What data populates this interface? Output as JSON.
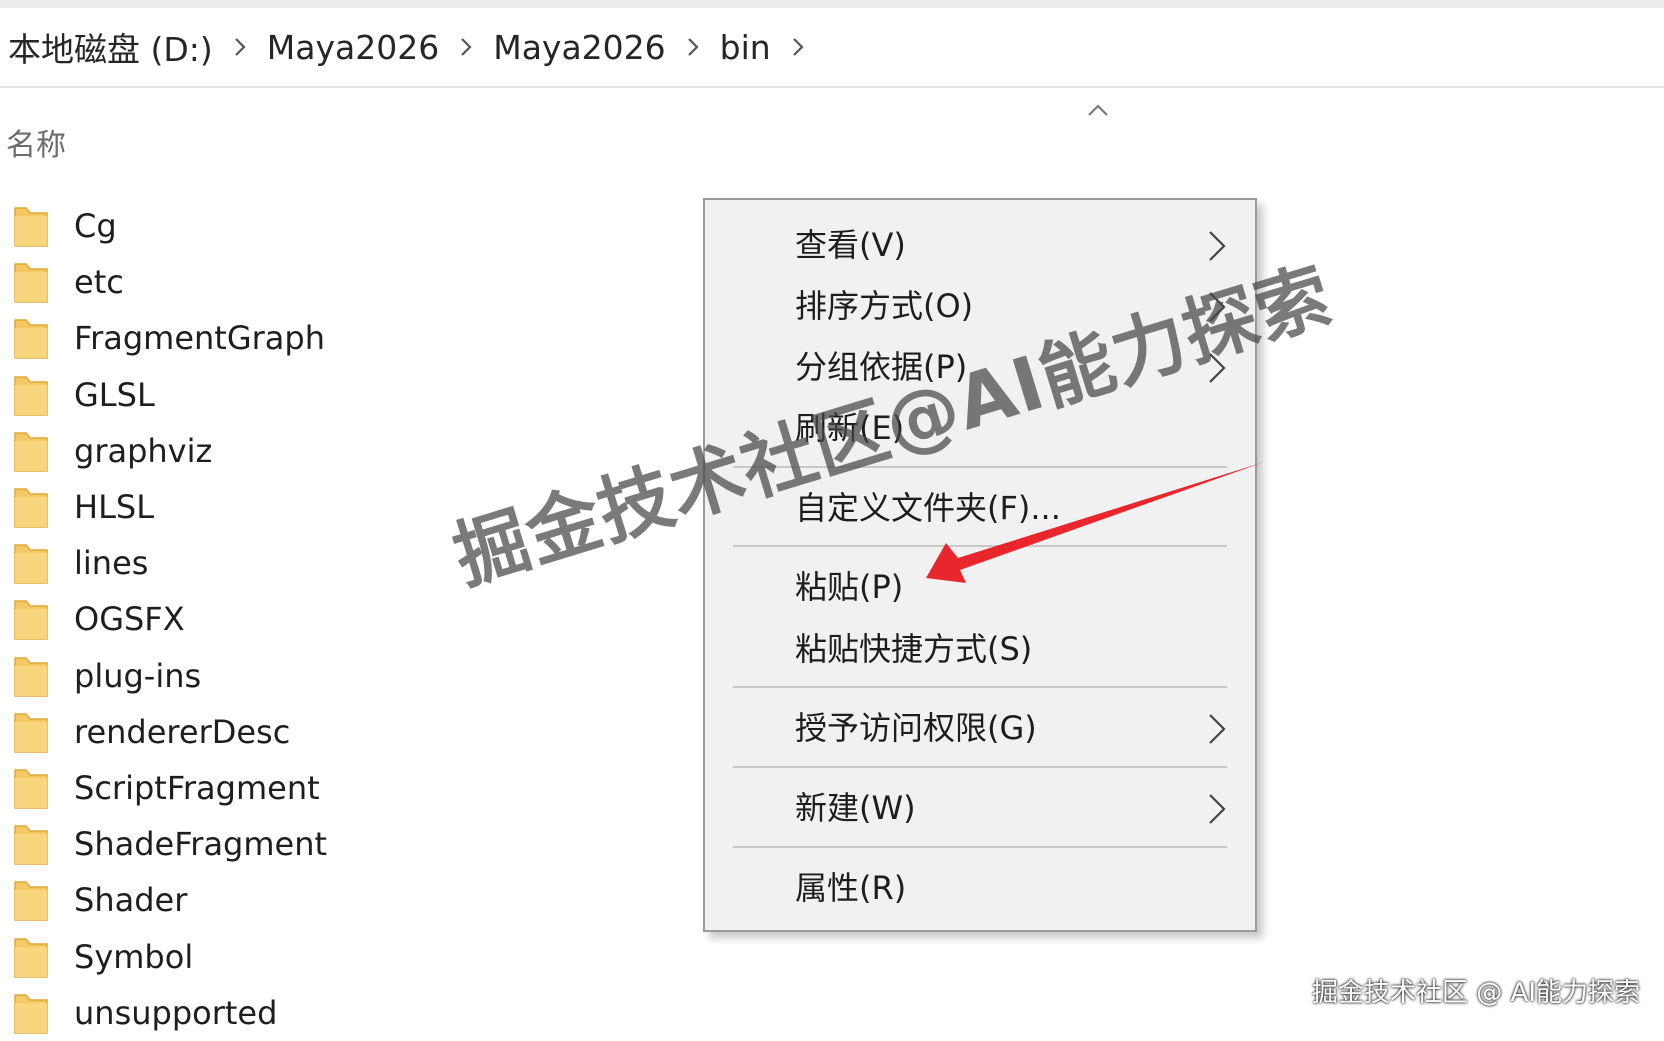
{
  "breadcrumb": [
    "本地磁盘 (D:)",
    "Maya2026",
    "Maya2026",
    "bin"
  ],
  "column_header": "名称",
  "files": [
    "Cg",
    "etc",
    "FragmentGraph",
    "GLSL",
    "graphviz",
    "HLSL",
    "lines",
    "OGSFX",
    "plug-ins",
    "rendererDesc",
    "ScriptFragment",
    "ShadeFragment",
    "Shader",
    "Symbol",
    "unsupported"
  ],
  "context_menu": {
    "view": "查看(V)",
    "sort_by": "排序方式(O)",
    "group_by": "分组依据(P)",
    "refresh": "刷新(E)",
    "customize_folder": "自定义文件夹(F)...",
    "paste": "粘贴(P)",
    "paste_shortcut": "粘贴快捷方式(S)",
    "give_access": "授予访问权限(G)",
    "new": "新建(W)",
    "properties": "属性(R)"
  },
  "watermark": "掘金技术社区@AI能力探索",
  "footer_watermark": "掘金技术社区 @ AI能力探索",
  "colors": {
    "folder": "#f4c862",
    "menu_bg": "#f1f1f1",
    "annotation_arrow": "#e8262c"
  }
}
